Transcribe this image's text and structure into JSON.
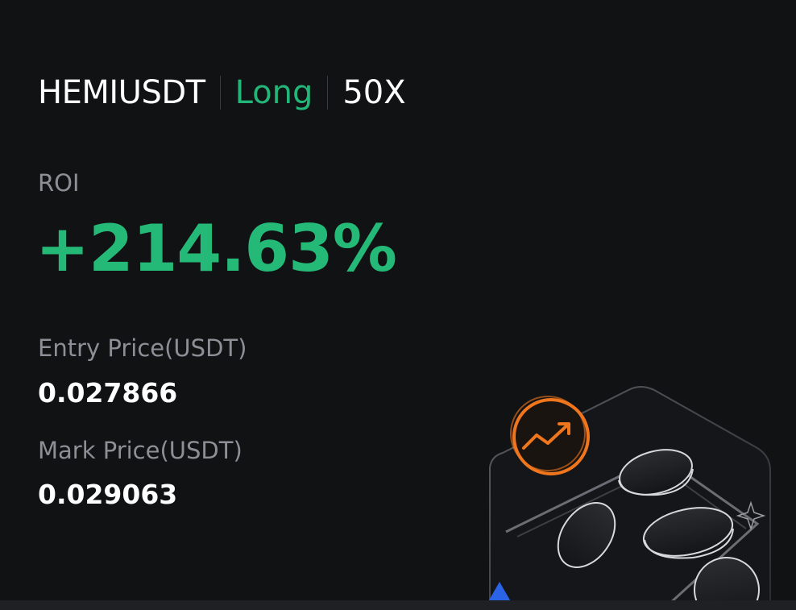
{
  "position": {
    "symbol": "HEMIUSDT",
    "side": "Long",
    "leverage": "50X"
  },
  "roi": {
    "label": "ROI",
    "value": "+214.63%"
  },
  "entry_price": {
    "label": "Entry Price(USDT)",
    "value": "0.027866"
  },
  "mark_price": {
    "label": "Mark Price(USDT)",
    "value": "0.029063"
  },
  "colors": {
    "background": "#111214",
    "profit_green": "#25b978",
    "muted_text": "#8c8f95",
    "accent_orange": "#f0761e"
  },
  "illustration": {
    "icons": [
      "trend-up-icon",
      "coin-icon",
      "sparkle-icon"
    ]
  }
}
